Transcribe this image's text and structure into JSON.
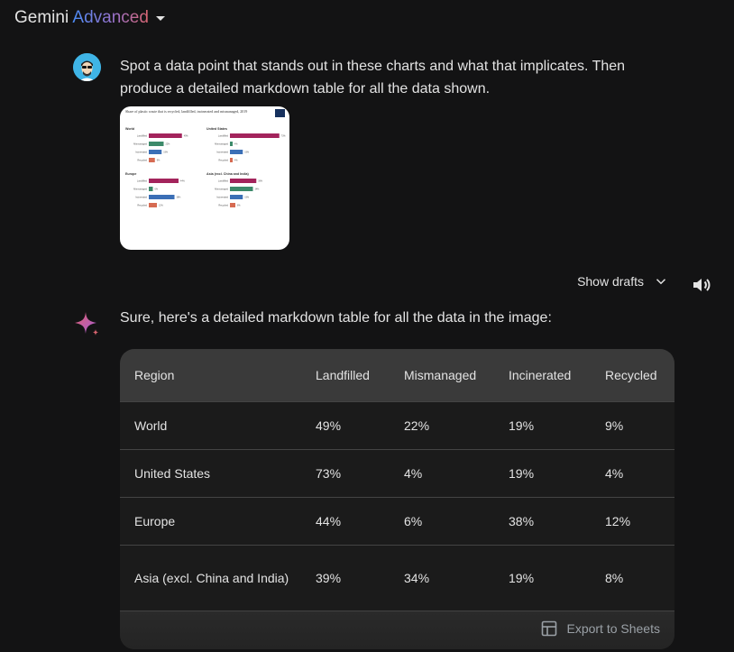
{
  "header": {
    "brand_main": "Gemini ",
    "brand_accent": "Advanced"
  },
  "prompt": {
    "text": "Spot a data point that stands out in these charts and what that implicates. Then produce a detailed markdown table for all the data shown."
  },
  "thumbnail": {
    "title": "Share of plastic waste that is recycled, landfilled, incinerated and mismanaged, 2019",
    "panels": [
      {
        "name": "World",
        "bars": [
          {
            "label": "Landfilled",
            "value": 49,
            "color": "#a3245c"
          },
          {
            "label": "Mismanaged",
            "value": 22,
            "color": "#3c8a6a"
          },
          {
            "label": "Incinerated",
            "value": 19,
            "color": "#3b6fb6"
          },
          {
            "label": "Recycled",
            "value": 9,
            "color": "#d66b52"
          }
        ]
      },
      {
        "name": "United States",
        "bars": [
          {
            "label": "Landfilled",
            "value": 73,
            "color": "#a3245c"
          },
          {
            "label": "Mismanaged",
            "value": 4,
            "color": "#3c8a6a"
          },
          {
            "label": "Incinerated",
            "value": 19,
            "color": "#3b6fb6"
          },
          {
            "label": "Recycled",
            "value": 4,
            "color": "#d66b52"
          }
        ]
      },
      {
        "name": "Europe",
        "bars": [
          {
            "label": "Landfilled",
            "value": 44,
            "color": "#a3245c"
          },
          {
            "label": "Mismanaged",
            "value": 6,
            "color": "#3c8a6a"
          },
          {
            "label": "Incinerated",
            "value": 38,
            "color": "#3b6fb6"
          },
          {
            "label": "Recycled",
            "value": 12,
            "color": "#d66b52"
          }
        ]
      },
      {
        "name": "Asia (excl. China and India)",
        "bars": [
          {
            "label": "Landfilled",
            "value": 39,
            "color": "#a3245c"
          },
          {
            "label": "Mismanaged",
            "value": 34,
            "color": "#3c8a6a"
          },
          {
            "label": "Incinerated",
            "value": 19,
            "color": "#3b6fb6"
          },
          {
            "label": "Recycled",
            "value": 8,
            "color": "#d66b52"
          }
        ]
      }
    ]
  },
  "drafts": {
    "label": "Show drafts"
  },
  "response": {
    "intro": "Sure, here's a detailed markdown table for all the data in the image:"
  },
  "table": {
    "headers": [
      "Region",
      "Landfilled",
      "Mismanaged",
      "Incinerated",
      "Recycled"
    ],
    "rows": [
      [
        "World",
        "49%",
        "22%",
        "19%",
        "9%"
      ],
      [
        "United States",
        "73%",
        "4%",
        "19%",
        "4%"
      ],
      [
        "Europe",
        "44%",
        "6%",
        "38%",
        "12%"
      ],
      [
        "Asia (excl. China and India)",
        "39%",
        "34%",
        "19%",
        "8%"
      ]
    ],
    "export_label": "Export to Sheets"
  },
  "colors": {
    "background": "#131314",
    "table_header": "#3a3a3a",
    "accent_blue": "#4a8cf7",
    "accent_pink": "#d96570"
  }
}
